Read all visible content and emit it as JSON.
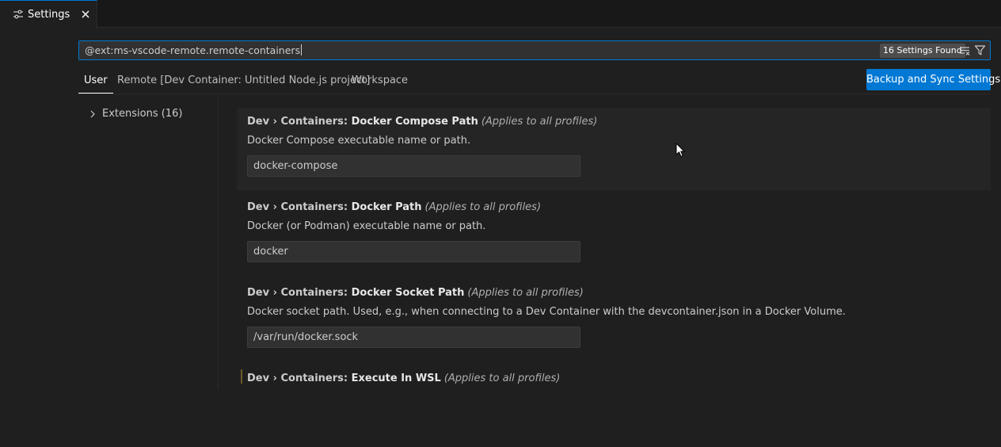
{
  "tab": {
    "label": "Settings",
    "icon": "settings-sliders-icon",
    "close_icon": "close-icon"
  },
  "search": {
    "value": "@ext:ms-vscode-remote.remote-containers",
    "count_badge": "16 Settings Found",
    "clear_icon": "clear-filter-icon",
    "filter_icon": "filter-icon"
  },
  "scope_tabs": [
    {
      "label": "User",
      "active": true
    },
    {
      "label": "Remote [Dev Container: Untitled Node.js project]",
      "active": false
    },
    {
      "label": "Workspace",
      "active": false
    }
  ],
  "backup_button": "Backup and Sync Settings",
  "toc": {
    "items": [
      {
        "label": "Extensions (16)"
      }
    ]
  },
  "settings": [
    {
      "category": "Dev › Containers: ",
      "name": "Docker Compose Path",
      "scope": "(Applies to all profiles)",
      "description": "Docker Compose executable name or path.",
      "value": "docker-compose"
    },
    {
      "category": "Dev › Containers: ",
      "name": "Docker Path",
      "scope": "(Applies to all profiles)",
      "description": "Docker (or Podman) executable name or path.",
      "value": "docker"
    },
    {
      "category": "Dev › Containers: ",
      "name": "Docker Socket Path",
      "scope": "(Applies to all profiles)",
      "description": "Docker socket path. Used, e.g., when connecting to a Dev Container with the devcontainer.json in a Docker Volume.",
      "value": "/var/run/docker.sock"
    },
    {
      "category": "Dev › Containers: ",
      "name": "Execute In WSL",
      "scope": "(Applies to all profiles)"
    }
  ],
  "colors": {
    "accent": "#0078d4",
    "background": "#1f1f1f",
    "input_background": "#313131"
  }
}
